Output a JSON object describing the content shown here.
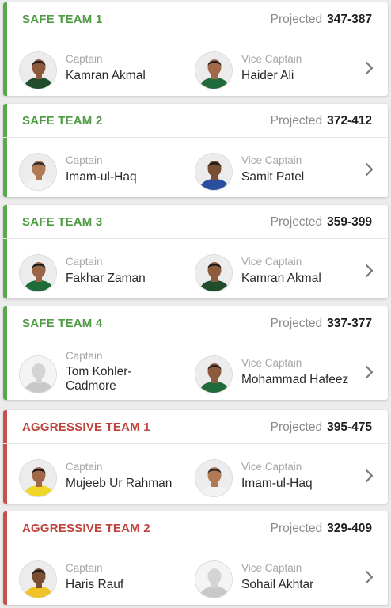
{
  "labels": {
    "projected": "Projected",
    "captain": "Captain",
    "vice_captain": "Vice Captain"
  },
  "colors": {
    "safe_accent": "#59a84c",
    "aggressive_accent": "#c9514c"
  },
  "icons": {
    "chevron": "chevron-right-icon",
    "avatar": "player-avatar-icon"
  },
  "teams": [
    {
      "type": "safe",
      "title": "SAFE TEAM 1",
      "range": "347-387",
      "captain": {
        "name": "Kamran Akmal",
        "skin": "#8d5a3c",
        "hair": "#1b1b1b",
        "jersey": "#1f4d2b"
      },
      "vice_captain": {
        "name": "Haider Ali",
        "skin": "#a0694a",
        "hair": "#1b1b1b",
        "jersey": "#1f6b3a"
      }
    },
    {
      "type": "safe",
      "title": "SAFE TEAM 2",
      "range": "372-412",
      "captain": {
        "name": "Imam-ul-Haq",
        "skin": "#b07a55",
        "hair": "#2a2a2a",
        "jersey": "#f2f2f2"
      },
      "vice_captain": {
        "name": "Samit Patel",
        "skin": "#7a4e33",
        "hair": "#1b1b1b",
        "jersey": "#2a4f9e"
      }
    },
    {
      "type": "safe",
      "title": "SAFE TEAM 3",
      "range": "359-399",
      "captain": {
        "name": "Fakhar Zaman",
        "skin": "#9a6446",
        "hair": "#1b1b1b",
        "jersey": "#1f6b3a"
      },
      "vice_captain": {
        "name": "Kamran Akmal",
        "skin": "#8d5a3c",
        "hair": "#1b1b1b",
        "jersey": "#1f4d2b"
      }
    },
    {
      "type": "safe",
      "title": "SAFE TEAM 4",
      "range": "337-377",
      "captain": {
        "name": "Tom Kohler-Cadmore",
        "skin": "",
        "hair": "",
        "jersey": ""
      },
      "vice_captain": {
        "name": "Mohammad Hafeez",
        "skin": "#8d5a3c",
        "hair": "#222222",
        "jersey": "#1f6b3a"
      }
    },
    {
      "type": "aggressive",
      "title": "AGGRESSIVE TEAM 1",
      "range": "395-475",
      "captain": {
        "name": "Mujeeb Ur Rahman",
        "skin": "#a0694a",
        "hair": "#1b1b1b",
        "jersey": "#f1d62a"
      },
      "vice_captain": {
        "name": "Imam-ul-Haq",
        "skin": "#b07a55",
        "hair": "#2a2a2a",
        "jersey": "#f2f2f2"
      }
    },
    {
      "type": "aggressive",
      "title": "AGGRESSIVE TEAM 2",
      "range": "329-409",
      "captain": {
        "name": "Haris Rauf",
        "skin": "#7a4e33",
        "hair": "#1b1b1b",
        "jersey": "#f1c12a"
      },
      "vice_captain": {
        "name": "Sohail Akhtar",
        "skin": "",
        "hair": "",
        "jersey": ""
      }
    }
  ]
}
